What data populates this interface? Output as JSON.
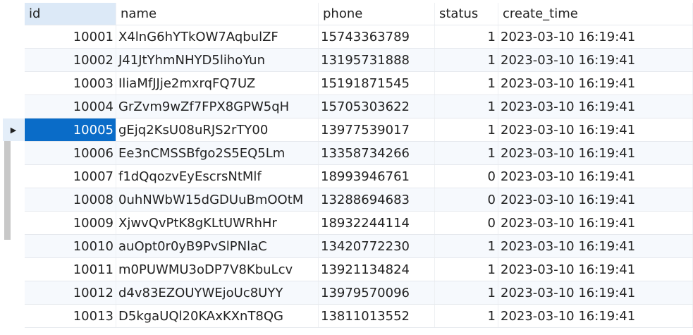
{
  "columns": [
    "id",
    "name",
    "phone",
    "status",
    "create_time"
  ],
  "selected_row": 4,
  "rows": [
    [
      "10001",
      "X4lnG6hYTkOW7AqbulZF",
      "15743363789",
      "1",
      "2023-03-10 16:19:41"
    ],
    [
      "10002",
      "J41JtYhmNHYD5lihoYun",
      "13195731888",
      "1",
      "2023-03-10 16:19:41"
    ],
    [
      "10003",
      "IliaMfJJje2mxrqFQ7UZ",
      "15191871545",
      "1",
      "2023-03-10 16:19:41"
    ],
    [
      "10004",
      "GrZvm9wZf7FPX8GPW5qH",
      "15705303622",
      "1",
      "2023-03-10 16:19:41"
    ],
    [
      "10005",
      "gEjq2KsU08uRJS2rTY00",
      "13977539017",
      "1",
      "2023-03-10 16:19:41"
    ],
    [
      "10006",
      "Ee3nCMSSBfgo2S5EQ5Lm",
      "13358734266",
      "1",
      "2023-03-10 16:19:41"
    ],
    [
      "10007",
      "f1dQqozvEyEscrsNtMlf",
      "18993946761",
      "0",
      "2023-03-10 16:19:41"
    ],
    [
      "10008",
      "0uhNWbW15dGDUuBmOOtM",
      "13288694683",
      "0",
      "2023-03-10 16:19:41"
    ],
    [
      "10009",
      "XjwvQvPtK8gKLtUWRhHr",
      "18932244114",
      "0",
      "2023-03-10 16:19:41"
    ],
    [
      "10010",
      "auOpt0r0yB9PvSlPNlaC",
      "13420772230",
      "1",
      "2023-03-10 16:19:41"
    ],
    [
      "10011",
      "m0PUWMU3oDP7V8KbuLcv",
      "13921134824",
      "1",
      "2023-03-10 16:19:41"
    ],
    [
      "10012",
      "d4v83EZOUYWEjoUc8UYY",
      "13979570096",
      "1",
      "2023-03-10 16:19:41"
    ],
    [
      "10013",
      "D5kgaUQl20KAxKXnT8QG",
      "13811013552",
      "1",
      "2023-03-10 16:19:41"
    ]
  ]
}
